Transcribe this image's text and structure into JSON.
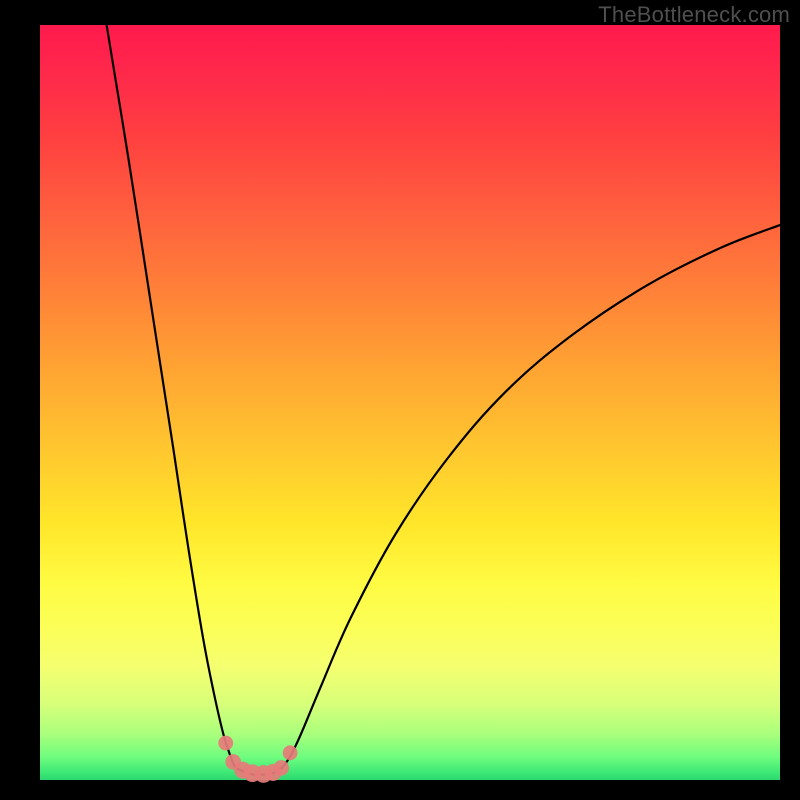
{
  "watermark": "TheBottleneck.com",
  "colors": {
    "curve": "#000000",
    "markers": "#e77b79",
    "gradient_top": "#ff1a4d",
    "gradient_bottom": "#2bd76f"
  },
  "chart_data": {
    "type": "line",
    "title": "",
    "xlabel": "",
    "ylabel": "",
    "xlim": [
      0,
      100
    ],
    "ylim": [
      0,
      100
    ],
    "grid": false,
    "legend": false,
    "annotations": [],
    "series": [
      {
        "name": "left-branch",
        "x": [
          9.0,
          12.0,
          15.0,
          18.0,
          20.0,
          22.0,
          23.5,
          24.8,
          25.8,
          26.4,
          27.4
        ],
        "y": [
          100.0,
          82.0,
          63.0,
          44.0,
          31.0,
          19.0,
          11.5,
          6.0,
          3.0,
          1.7,
          1.2
        ]
      },
      {
        "name": "valley-floor",
        "x": [
          27.4,
          28.5,
          29.7,
          30.9,
          32.1
        ],
        "y": [
          1.2,
          0.8,
          0.7,
          0.8,
          1.2
        ]
      },
      {
        "name": "right-branch",
        "x": [
          32.1,
          33.4,
          35.0,
          38.0,
          42.0,
          48.0,
          55.0,
          63.0,
          72.0,
          82.0,
          92.0,
          100.0
        ],
        "y": [
          1.2,
          2.5,
          5.5,
          12.5,
          21.5,
          32.5,
          42.5,
          51.5,
          59.0,
          65.5,
          70.5,
          73.5
        ]
      }
    ],
    "markers": {
      "name": "valley-markers",
      "shape": "circle",
      "x": [
        25.1,
        26.1,
        27.4,
        28.7,
        30.2,
        31.5,
        32.6,
        33.8
      ],
      "y": [
        4.9,
        2.4,
        1.3,
        0.9,
        0.8,
        1.0,
        1.6,
        3.6
      ],
      "r": [
        1.0,
        1.05,
        1.15,
        1.2,
        1.2,
        1.15,
        1.05,
        1.0
      ]
    }
  }
}
